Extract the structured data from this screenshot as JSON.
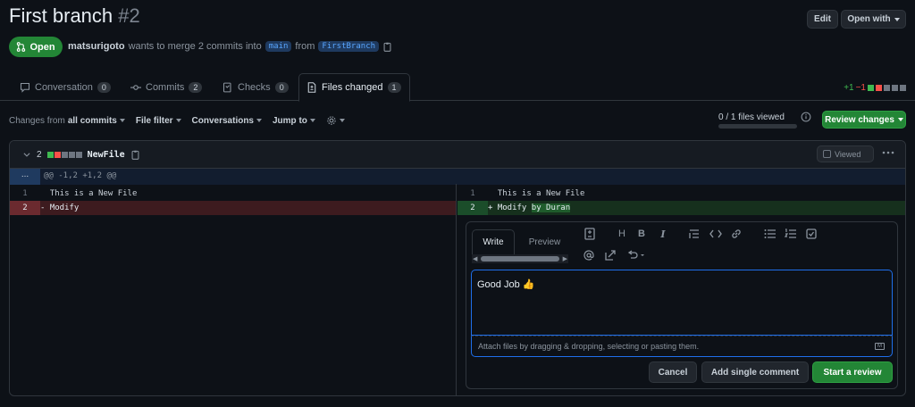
{
  "header": {
    "title": "First branch",
    "number": "#2",
    "edit_label": "Edit",
    "open_with_label": "Open with"
  },
  "pr": {
    "state": "Open",
    "author": "matsurigoto",
    "merge_text": "wants to merge 2 commits into",
    "base_branch": "main",
    "from_text": "from",
    "head_branch": "FirstBranch"
  },
  "tabs": [
    {
      "label": "Conversation",
      "count": "0"
    },
    {
      "label": "Commits",
      "count": "2"
    },
    {
      "label": "Checks",
      "count": "0"
    },
    {
      "label": "Files changed",
      "count": "1"
    }
  ],
  "diffstat": {
    "additions": "+1",
    "deletions": "−1"
  },
  "toolbar": {
    "changes_from_prefix": "Changes from",
    "changes_from_value": "all commits",
    "file_filter": "File filter",
    "conversations": "Conversations",
    "jump_to": "Jump to",
    "files_viewed": "0 / 1 files viewed",
    "review_changes": "Review changes"
  },
  "file": {
    "change_count": "2",
    "name": "NewFile",
    "viewed_label": "Viewed",
    "hunk_expand": "...",
    "hunk_header": "@@ -1,2 +1,2 @@",
    "left_lines": [
      {
        "num": "1",
        "text": "  This is a New File"
      },
      {
        "num": "2",
        "text": "- Modify"
      }
    ],
    "right_lines": [
      {
        "num": "1",
        "text": "  This is a New File"
      },
      {
        "num": "2",
        "prefix": "+ Modify ",
        "highlight": "by Duran"
      }
    ]
  },
  "comment": {
    "write_tab": "Write",
    "preview_tab": "Preview",
    "text": "Good Job 👍",
    "attach_hint": "Attach files by dragging & dropping, selecting or pasting them.",
    "cancel": "Cancel",
    "add_single": "Add single comment",
    "start_review": "Start a review"
  },
  "colors": {
    "background": "#0d1117",
    "accent_green": "#238636",
    "link_blue": "#58a6ff",
    "deletion_red": "#f85149",
    "addition_green": "#3fb950"
  }
}
